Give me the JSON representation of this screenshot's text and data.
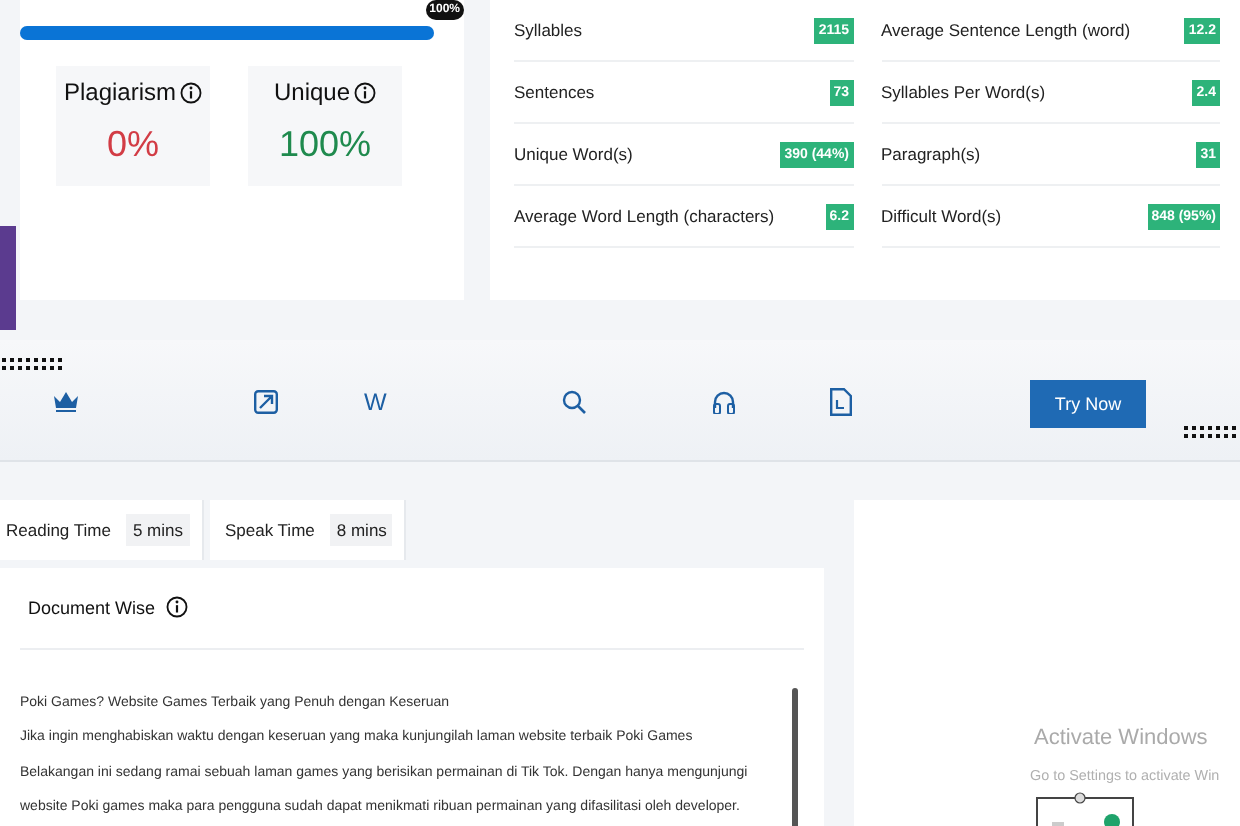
{
  "progress": {
    "label": "100%"
  },
  "scores": [
    {
      "label": "Plagiarism",
      "value": "0%",
      "color": "#d23c45"
    },
    {
      "label": "Unique",
      "value": "100%",
      "color": "#1f8a4e"
    }
  ],
  "stats": {
    "columns": [
      [
        {
          "label": "Syllables",
          "value": "2115"
        },
        {
          "label": "Sentences",
          "value": "73"
        },
        {
          "label": "Unique Word(s)",
          "value": "390 (44%)"
        },
        {
          "label": "Average Word Length (characters)",
          "value": "6.2"
        }
      ],
      [
        {
          "label": "Average Sentence Length (word)",
          "value": "12.2"
        },
        {
          "label": "Syllables Per Word(s)",
          "value": "2.4"
        },
        {
          "label": "Paragraph(s)",
          "value": "31"
        },
        {
          "label": "Difficult Word(s)",
          "value": "848 (95%)"
        }
      ]
    ]
  },
  "toolbar": {
    "items": [
      {
        "kind": "crown"
      },
      {
        "kind": "chart"
      },
      {
        "kind": "letter",
        "text": "W"
      },
      {
        "kind": "search"
      },
      {
        "kind": "headphones"
      },
      {
        "kind": "file"
      }
    ],
    "button": "Try Now"
  },
  "times": [
    {
      "label": "Reading Time",
      "value": "5 mins"
    },
    {
      "label": "Speak Time",
      "value": "8 mins"
    }
  ],
  "document": {
    "title": "Document Wise",
    "lines": [
      "Poki Games? Website Games Terbaik yang Penuh dengan Keseruan",
      "Jika ingin menghabiskan waktu dengan keseruan yang maka kunjungilah laman website terbaik Poki Games",
      "Belakangan ini sedang ramai sebuah laman games yang berisikan permainan di Tik Tok. Dengan hanya mengunjungi",
      "website Poki games maka para pengguna sudah dapat menikmati ribuan permainan yang difasilitasi oleh developer."
    ]
  },
  "activation": {
    "title": "Activate Windows",
    "subtitle": "Go to Settings to activate Win"
  }
}
